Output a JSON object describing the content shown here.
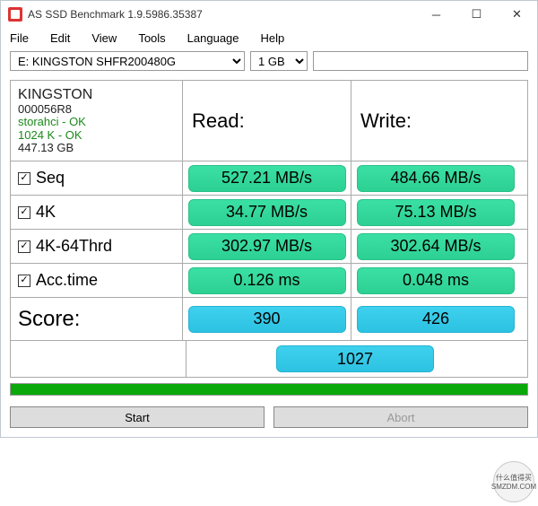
{
  "window": {
    "title": "AS SSD Benchmark 1.9.5986.35387"
  },
  "menu": {
    "file": "File",
    "edit": "Edit",
    "view": "View",
    "tools": "Tools",
    "language": "Language",
    "help": "Help"
  },
  "toolbar": {
    "drive": "E: KINGSTON SHFR200480G",
    "size": "1 GB"
  },
  "info": {
    "product": "KINGSTON",
    "firmware": "000056R8",
    "driver": "storahci - OK",
    "align": "1024 K - OK",
    "capacity": "447.13 GB"
  },
  "headers": {
    "read": "Read:",
    "write": "Write:",
    "score": "Score:"
  },
  "tests": {
    "seq": {
      "label": "Seq",
      "read": "527.21 MB/s",
      "write": "484.66 MB/s",
      "checked": true
    },
    "fourk": {
      "label": "4K",
      "read": "34.77 MB/s",
      "write": "75.13 MB/s",
      "checked": true
    },
    "fourk64": {
      "label": "4K-64Thrd",
      "read": "302.97 MB/s",
      "write": "302.64 MB/s",
      "checked": true
    },
    "acc": {
      "label": "Acc.time",
      "read": "0.126 ms",
      "write": "0.048 ms",
      "checked": true
    }
  },
  "scores": {
    "read": "390",
    "write": "426",
    "total": "1027"
  },
  "buttons": {
    "start": "Start",
    "abort": "Abort"
  },
  "watermark": {
    "line1": "什么值得买",
    "line2": "SMZDM.COM"
  }
}
